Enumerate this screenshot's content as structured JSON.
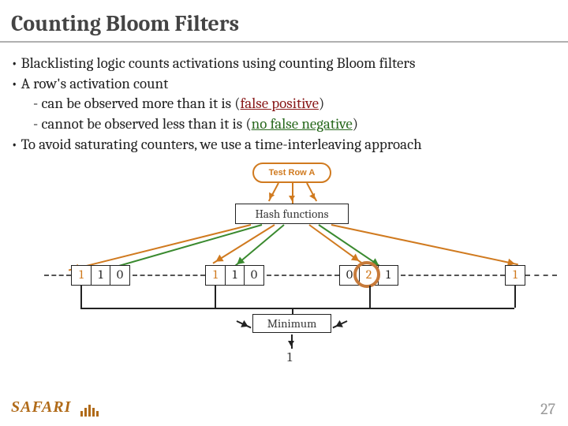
{
  "title": "Counting Bloom Filters",
  "bullets": {
    "b1": "Blacklisting logic counts activations using counting Bloom filters",
    "b2": "A row's activation count",
    "b2a_pre": "can be observed more than it is (",
    "b2a_em": "false positive",
    "b2a_post": ")",
    "b2b_pre": "cannot be observed less than it is (",
    "b2b_em": "no false negative",
    "b2b_post": ")",
    "b3": "To avoid saturating counters, we use a time-interleaving approach"
  },
  "diagram": {
    "test_row": "Test Row A",
    "hash_box": "Hash functions",
    "minimum_label": "Minimum",
    "minimum_value": "1",
    "groups": [
      [
        "1",
        "1",
        "0"
      ],
      [
        "1",
        "1",
        "0"
      ],
      [
        "0",
        "2",
        "1"
      ],
      [
        "1"
      ]
    ],
    "circle_target_group": 2,
    "circle_target_index": 1
  },
  "page_number": "27",
  "logo_text": "SAFARI"
}
